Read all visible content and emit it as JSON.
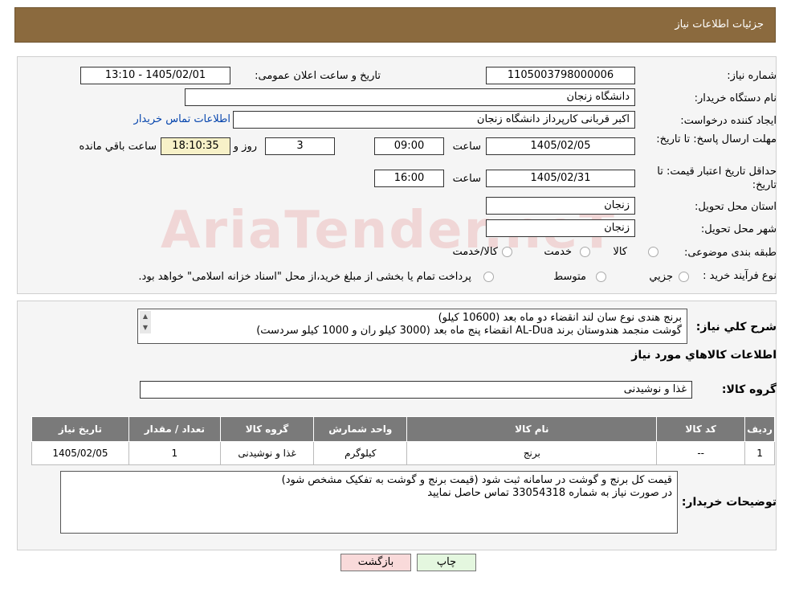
{
  "header": {
    "title": "جزئیات اطلاعات نیاز"
  },
  "watermark": "AriaTender.neT",
  "form": {
    "need_number_label": "شماره نیاز:",
    "need_number": "1105003798000006",
    "announce_label": "تاریخ و ساعت اعلان عمومی:",
    "announce_value": "1405/02/01 - 13:10",
    "buyer_org_label": "نام دستگاه خريدار:",
    "buyer_org": "دانشگاه زنجان",
    "requester_label": "ایجاد کننده درخواست:",
    "requester": "اکبر قربانی کارپرداز دانشگاه زنجان",
    "contact_link": "اطلاعات تماس خریدار",
    "deadline_label": "مهلت ارسال پاسخ: تا تاریخ:",
    "deadline_date": "1405/02/05",
    "time_label": "ساعت",
    "deadline_time": "09:00",
    "days_value": "3",
    "days_label": "روز و",
    "remaining_time": "18:10:35",
    "remaining_label": "ساعت باقي مانده",
    "validity_label": "حداقل تاریخ اعتبار قیمت: تا تاریخ:",
    "validity_date": "1405/02/31",
    "validity_time": "16:00",
    "province_label": "استان محل تحویل:",
    "province": "زنجان",
    "city_label": "شهر محل تحویل:",
    "city": "زنجان",
    "category_label": "طبقه بندی موضوعی:",
    "category_options": [
      "کالا",
      "خدمت",
      "کالا/خدمت"
    ],
    "process_label": "نوع فرآیند خرید :",
    "process_options": [
      "جزیي",
      "متوسط"
    ],
    "process_note": "پرداخت تمام یا بخشی از مبلغ خرید،از محل \"اسناد خزانه اسلامی\" خواهد بود."
  },
  "summary": {
    "label": "شرح کلي نياز:",
    "line1": "برنج هندی نوع سان لند انقضاء دو ماه بعد (10600 کیلو)",
    "line2": "گوشت منجمد هندوستان برند AL-Dua انقضاء پنج ماه بعد (3000 کیلو ران و 1000 کیلو سردست)"
  },
  "goods": {
    "section_title": "اطلاعات کالاهاي مورد نياز",
    "group_label": "گروه کالا:",
    "group_value": "غذا و نوشیدنی",
    "columns": [
      "رديف",
      "کد کالا",
      "نام کالا",
      "واحد شمارش",
      "گروه کالا",
      "تعداد / مقدار",
      "تاریخ نیاز"
    ],
    "rows": [
      [
        "1",
        "--",
        "برنج",
        "کیلوگرم",
        "غذا و نوشیدنی",
        "1",
        "1405/02/05"
      ]
    ]
  },
  "notes": {
    "label": "توضیحات خریدار:",
    "line1": "قیمت کل برنج و گوشت در سامانه ثبت شود (قیمت برنج و گوشت به تفکیک مشخص شود)",
    "line2": "در صورت نیاز به شماره 33054318 تماس حاصل نمایید"
  },
  "buttons": {
    "print": "چاپ",
    "back": "بازگشت"
  },
  "colors": {
    "header_bg": "#8b6a3e",
    "table_header_bg": "#7a7a7a",
    "remaining_bg": "#f7f1c8",
    "back_button_bg": "#f9dada",
    "print_button_bg": "#e4f7df"
  }
}
